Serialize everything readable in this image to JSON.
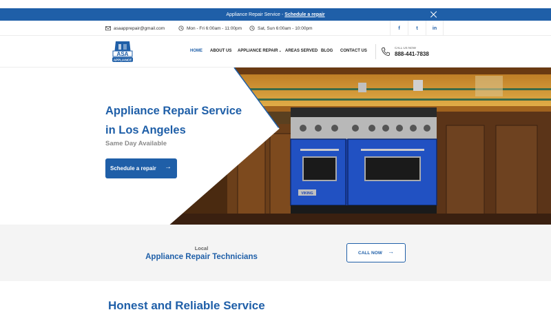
{
  "announcement": {
    "text": "Appliance Repair Service",
    "separator": "-",
    "link": "Schedule a repair"
  },
  "topbar": {
    "email": "asaapprepair@gmail.com",
    "hours_weekday": "Mon - Fri 6:00am - 11:00pm",
    "hours_weekend": "Sat, Sun 6:00am - 10:00pm",
    "social": [
      "f",
      "t",
      "in"
    ]
  },
  "header": {
    "logo_text": "ASA",
    "logo_subtext": "APPLIANCE",
    "nav": [
      "HOME",
      "ABOUT US",
      "APPLIANCE REPAIR",
      "AREAS SERVED",
      "BLOG",
      "CONTACT US"
    ],
    "call_label": "CALL US NOW",
    "phone": "888-441-7838"
  },
  "hero": {
    "title_line1": "Appliance Repair Service",
    "title_line2": "in Los Angeles",
    "subtitle": "Same Day Available",
    "button": "Schedule a repair",
    "oven_brand": "VIKING"
  },
  "local": {
    "small": "Local",
    "big": "Appliance Repair Technicians",
    "button": "CALL NOW"
  },
  "section": {
    "title": "Honest and Reliable Service"
  },
  "colors": {
    "brand_blue": "#1f5fa8",
    "light_bg": "#f4f4f4"
  }
}
